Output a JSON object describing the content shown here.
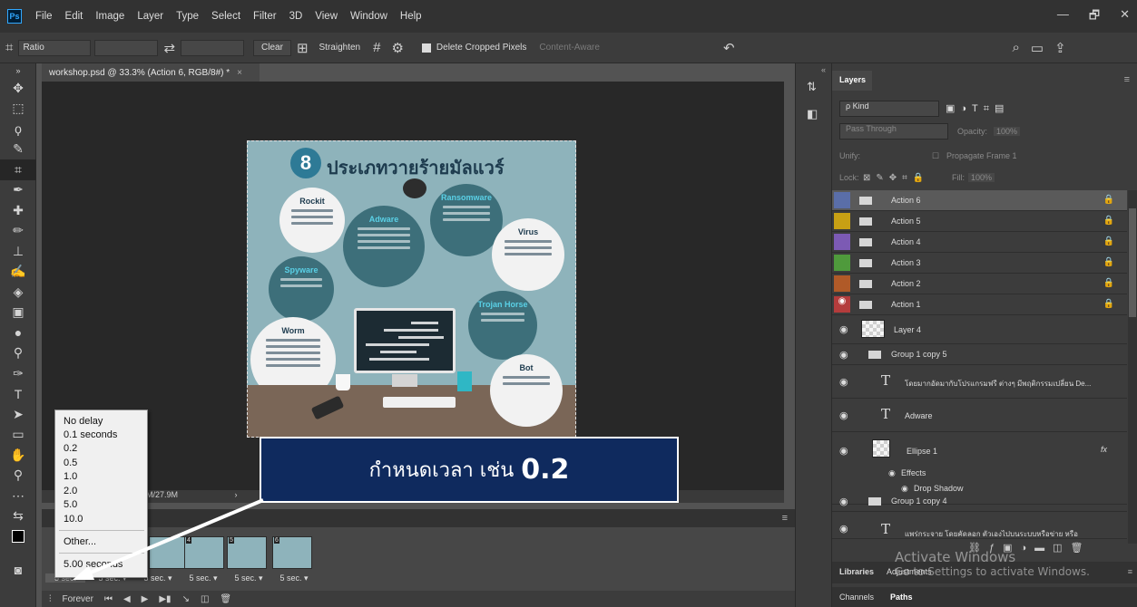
{
  "app": {
    "logo_text": "Ps",
    "menu": [
      "File",
      "Edit",
      "Image",
      "Layer",
      "Type",
      "Select",
      "Filter",
      "3D",
      "View",
      "Window",
      "Help"
    ],
    "window_controls": [
      "—",
      "🗗",
      "✕"
    ]
  },
  "options_bar": {
    "ratio_label": "Ratio",
    "clear_label": "Clear",
    "straighten_label": "Straighten",
    "delete_cropped_label": "Delete Cropped Pixels",
    "content_aware_label": "Content-Aware"
  },
  "document": {
    "tab_title": "workshop.psd @ 33.3% (Action 6, RGB/8#) *",
    "tab_close": "×",
    "status_text": "M/27.9M"
  },
  "artwork": {
    "number": "8",
    "title": "ประเภทวายร้ายมัลแวร์",
    "bubbles": [
      {
        "title": "Rockit"
      },
      {
        "title": "Adware"
      },
      {
        "title": "Ransomware"
      },
      {
        "title": "Virus"
      },
      {
        "title": "Spyware"
      },
      {
        "title": "Trojan Horse"
      },
      {
        "title": "Worm"
      },
      {
        "title": "Bot"
      }
    ]
  },
  "annotation": {
    "text": "กำหนดเวลา เช่น",
    "value": "0.2"
  },
  "delay_menu": {
    "items": [
      "No delay",
      "0.1 seconds",
      "0.2",
      "0.5",
      "1.0",
      "2.0",
      "5.0",
      "10.0"
    ],
    "other": "Other...",
    "current": "5.00 seconds"
  },
  "timeline": {
    "frames": [
      {
        "num": "",
        "delay": "5 sec. ▾"
      },
      {
        "num": "",
        "delay": "5 sec. ▾"
      },
      {
        "num": "4",
        "delay": "5 sec. ▾"
      },
      {
        "num": "5",
        "delay": "5 sec. ▾"
      },
      {
        "num": "6",
        "delay": "5 sec. ▾"
      }
    ],
    "first_delay": "5 sec.",
    "loop": "Forever"
  },
  "layers_panel": {
    "tab": "Layers",
    "kind_label": "ρ Kind",
    "blend_mode": "Pass Through",
    "opacity_label": "Opacity:",
    "opacity_value": "100%",
    "unify_label": "Unify:",
    "propagate_label": "Propagate Frame 1",
    "lock_label": "Lock:",
    "fill_label": "Fill:",
    "fill_value": "100%",
    "layers": [
      {
        "name": "Action 6",
        "color": "#5a6ea8"
      },
      {
        "name": "Action 5",
        "color": "#c8a014"
      },
      {
        "name": "Action 4",
        "color": "#7c5ab4"
      },
      {
        "name": "Action 3",
        "color": "#4f9a3c"
      },
      {
        "name": "Action 2",
        "color": "#b05a28"
      },
      {
        "name": "Action 1",
        "color": "#b43c3c"
      }
    ],
    "layer4": "Layer 4",
    "group1copy5": "Group 1 copy 5",
    "text_layer_1": "โดยมากอัดมากับโปรแกรมฟรี ต่างๆ มีพฤติกรรมเปลี่ยน De...",
    "text_layer_2": "Adware",
    "ellipse": "Ellipse 1",
    "effects": "Effects",
    "drop_shadow": "Drop Shadow",
    "group1copy4": "Group 1 copy 4",
    "text_layer_3": "แพร่กระจาย โดยคัดลอก ตัวเองไปบนระบบหรือข่าย หรือ",
    "fx": "fx"
  },
  "bottom_panels": {
    "libraries": "Libraries",
    "adjustments": "Adjustments",
    "channels": "Channels",
    "paths": "Paths"
  },
  "watermark": {
    "line1": "Activate Windows",
    "line2": "Go to Settings to activate Windows."
  }
}
